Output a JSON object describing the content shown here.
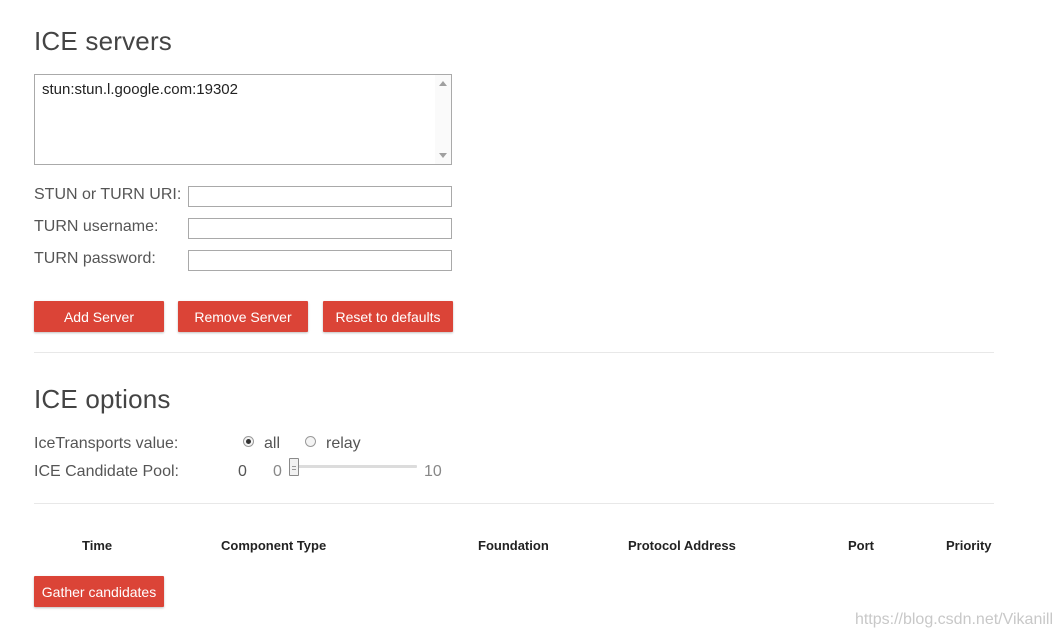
{
  "ice_servers": {
    "heading": "ICE servers",
    "list": [
      "stun:stun.l.google.com:19302"
    ],
    "fields": {
      "uri_label": "STUN or TURN URI:",
      "uri_value": "",
      "username_label": "TURN username:",
      "username_value": "",
      "password_label": "TURN password:",
      "password_value": ""
    },
    "buttons": {
      "add": "Add Server",
      "remove": "Remove Server",
      "reset": "Reset to defaults"
    }
  },
  "ice_options": {
    "heading": "ICE options",
    "transports_label": "IceTransports value:",
    "transport_all": "all",
    "transport_relay": "relay",
    "transport_selected": "all",
    "pool_label": "ICE Candidate Pool:",
    "pool_value": "0",
    "pool_min": "0",
    "pool_max": "10",
    "pool_level": 0
  },
  "candidates_table": {
    "columns": [
      "Time",
      "Component Type",
      "Foundation",
      "Protocol Address",
      "Port",
      "Priority"
    ]
  },
  "gather_button": "Gather candidates",
  "watermark": "https://blog.csdn.net/Vikanill",
  "colors": {
    "button_bg": "#db4437",
    "text": "#444444"
  }
}
